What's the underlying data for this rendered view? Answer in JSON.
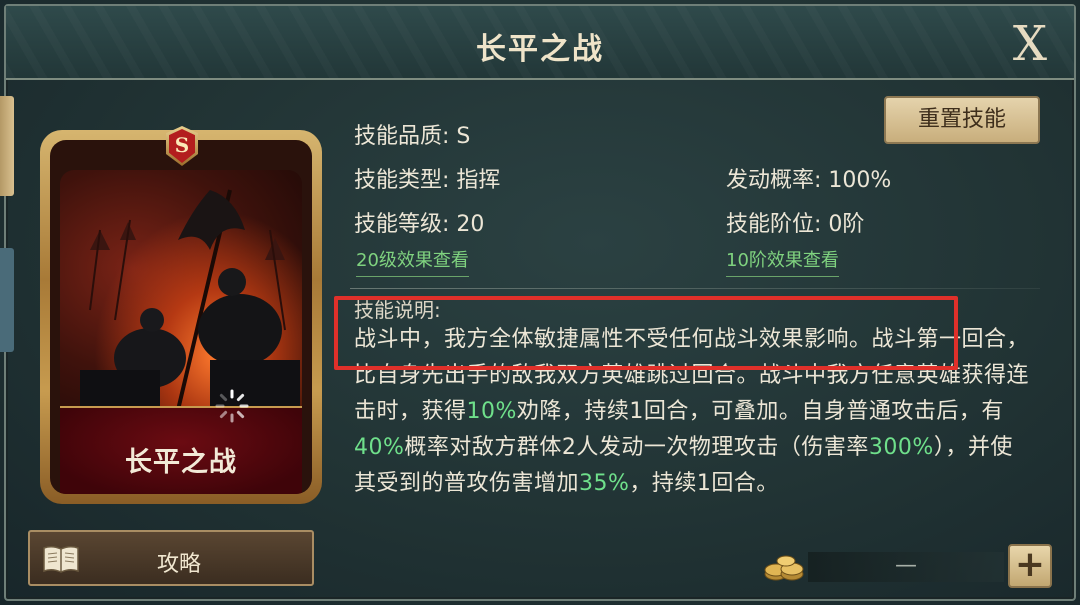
{
  "window": {
    "title": "长平之战",
    "close_label": "X"
  },
  "card": {
    "grade": "S",
    "name": "长平之战"
  },
  "guide_button": {
    "label": "攻略",
    "icon": "book-icon"
  },
  "reset_button": {
    "label": "重置技能"
  },
  "skill": {
    "quality": "技能品质: S",
    "type": "技能类型: 指挥",
    "level": "技能等级: 20",
    "trigger_rate": "发动概率: 100%",
    "rank": "技能阶位: 0阶",
    "level_effects_link": "20级效果查看",
    "rank_effects_link": "10阶效果查看",
    "description_label": "技能说明:",
    "description": {
      "p1": "战斗中，我方全体敏捷属性不受任何战斗效果影响。战斗第一回合，比自身先出手的敌我双方英雄跳过回合。战斗中我方任意英雄获得连击时，获得",
      "h1": "10%",
      "p2": "劝降，持续1回合，可叠加。自身普通攻击后，有",
      "h2": "40%",
      "p3": "概率对敌方群体2人发动一次物理攻击（伤害率",
      "h3": "300%",
      "p4": "），并使其受到的普攻伤害增加",
      "h4": "35%",
      "p5": "，持续1回合。"
    }
  },
  "upgrade": {
    "value": "—",
    "plus_label": "+",
    "coin_icon": "coin-stack-icon"
  },
  "colors": {
    "highlight": "#6fe08b",
    "annotation_box": "#e0302a",
    "link": "#7fd27f"
  }
}
